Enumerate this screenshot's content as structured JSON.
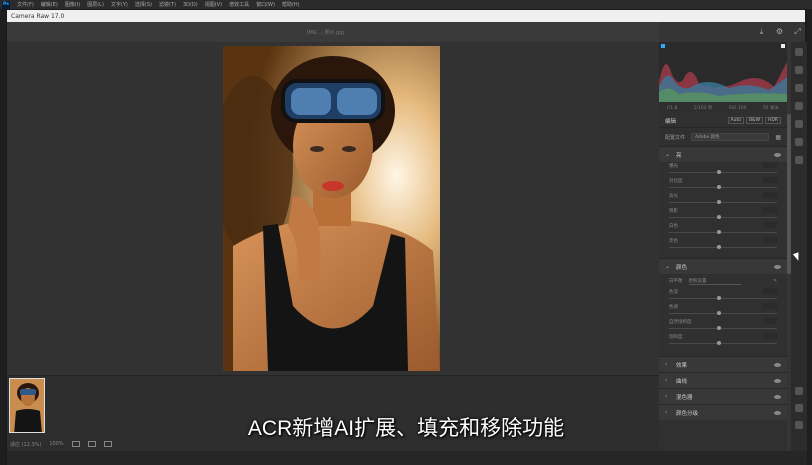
{
  "ps_menubar": {
    "logo": "Ps",
    "items": [
      "文件(F)",
      "编辑(E)",
      "图像(I)",
      "图层(L)",
      "文字(Y)",
      "选择(S)",
      "滤镜(T)",
      "3D(D)",
      "视图(V)",
      "增效工具",
      "窗口(W)",
      "帮助(H)"
    ]
  },
  "dialog": {
    "title": "Camera Raw 17.0",
    "preview_title": "IMG ... 照片.jpg"
  },
  "camera_info": [
    "f/1.8",
    "1/160 秒",
    "ISO 100",
    "50 毫米"
  ],
  "edit_panel": {
    "title": "编辑",
    "mode_buttons": [
      "Auto",
      "B&W",
      "HDR"
    ],
    "profile_label": "配置文件",
    "profile_value": "Adobe 颜色"
  },
  "sections": {
    "light": {
      "title": "亮",
      "sliders": [
        "曝光",
        "对比度",
        "高光",
        "阴影",
        "白色",
        "黑色"
      ]
    },
    "color": {
      "title": "颜色",
      "wb_label": "白平衡",
      "wb_value": "原照设置",
      "sliders": [
        "色温",
        "色调",
        "自然饱和度",
        "饱和度"
      ]
    },
    "collapsed": [
      "效果",
      "曲线",
      "混色器",
      "颜色分级"
    ]
  },
  "bottom_bar": {
    "zoom": "适应 (12.3%)",
    "percent": "100%"
  },
  "subtitle": "ACR新增AI扩展、填充和移除功能",
  "colors": {
    "dialog_bg": "#353535",
    "panel_bg": "#303030",
    "titlebar": "#f0f0f0",
    "accent_blue": "#31a8ff"
  }
}
